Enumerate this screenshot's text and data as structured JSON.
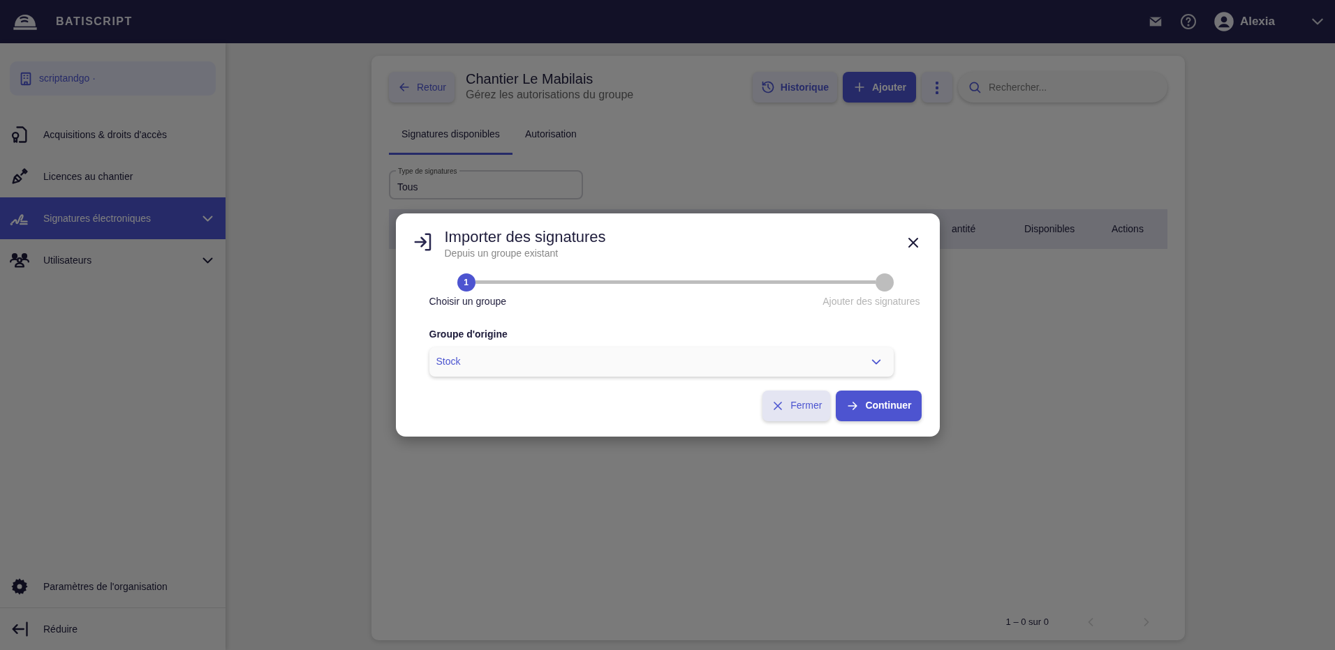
{
  "app": {
    "brand": "BATISCRIPT",
    "user": "Alexia"
  },
  "sidebar": {
    "organization": "scriptandgo ·",
    "items": [
      {
        "label": "Acquisitions & droits d'accès",
        "kind": "certificate",
        "selected": false,
        "expandable": false
      },
      {
        "label": "Licences au chantier",
        "kind": "shovel",
        "selected": false,
        "expandable": false
      },
      {
        "label": "Signatures électroniques",
        "kind": "signature",
        "selected": true,
        "expandable": true
      },
      {
        "label": "Utilisateurs",
        "kind": "users",
        "selected": false,
        "expandable": true
      }
    ],
    "footer": [
      {
        "label": "Paramètres de l'organisation",
        "kind": "gear"
      },
      {
        "label": "Réduire",
        "kind": "collapse"
      }
    ]
  },
  "page": {
    "back": "Retour",
    "title": "Chantier Le Mabilais",
    "subtitle": "Gérez les autorisations du groupe",
    "history": "Historique",
    "add": "Ajouter",
    "search": {
      "placeholder": "Rechercher..."
    },
    "tabs": [
      {
        "label": "Signatures disponibles",
        "selected": true
      },
      {
        "label": "Autorisation",
        "selected": false
      }
    ],
    "filter": {
      "label": "Type de signatures",
      "value": "Tous"
    },
    "table": {
      "columns": [
        "antité",
        "Disponibles",
        "Actions"
      ]
    },
    "pagination": {
      "range": "1 – 0 sur 0",
      "prev_disabled": true,
      "next_disabled": true
    }
  },
  "dialog": {
    "title": "Importer des signatures",
    "subtitle": "Depuis un groupe existant",
    "steps": [
      {
        "number": "1",
        "label": "Choisir un groupe",
        "active": true
      },
      {
        "label": "Ajouter des signatures",
        "active": false
      }
    ],
    "field": {
      "label": "Groupe d'origine",
      "value": "Stock"
    },
    "buttons": [
      {
        "label": "Fermer",
        "kind": "close"
      },
      {
        "label": "Continuer",
        "kind": "next"
      }
    ]
  }
}
